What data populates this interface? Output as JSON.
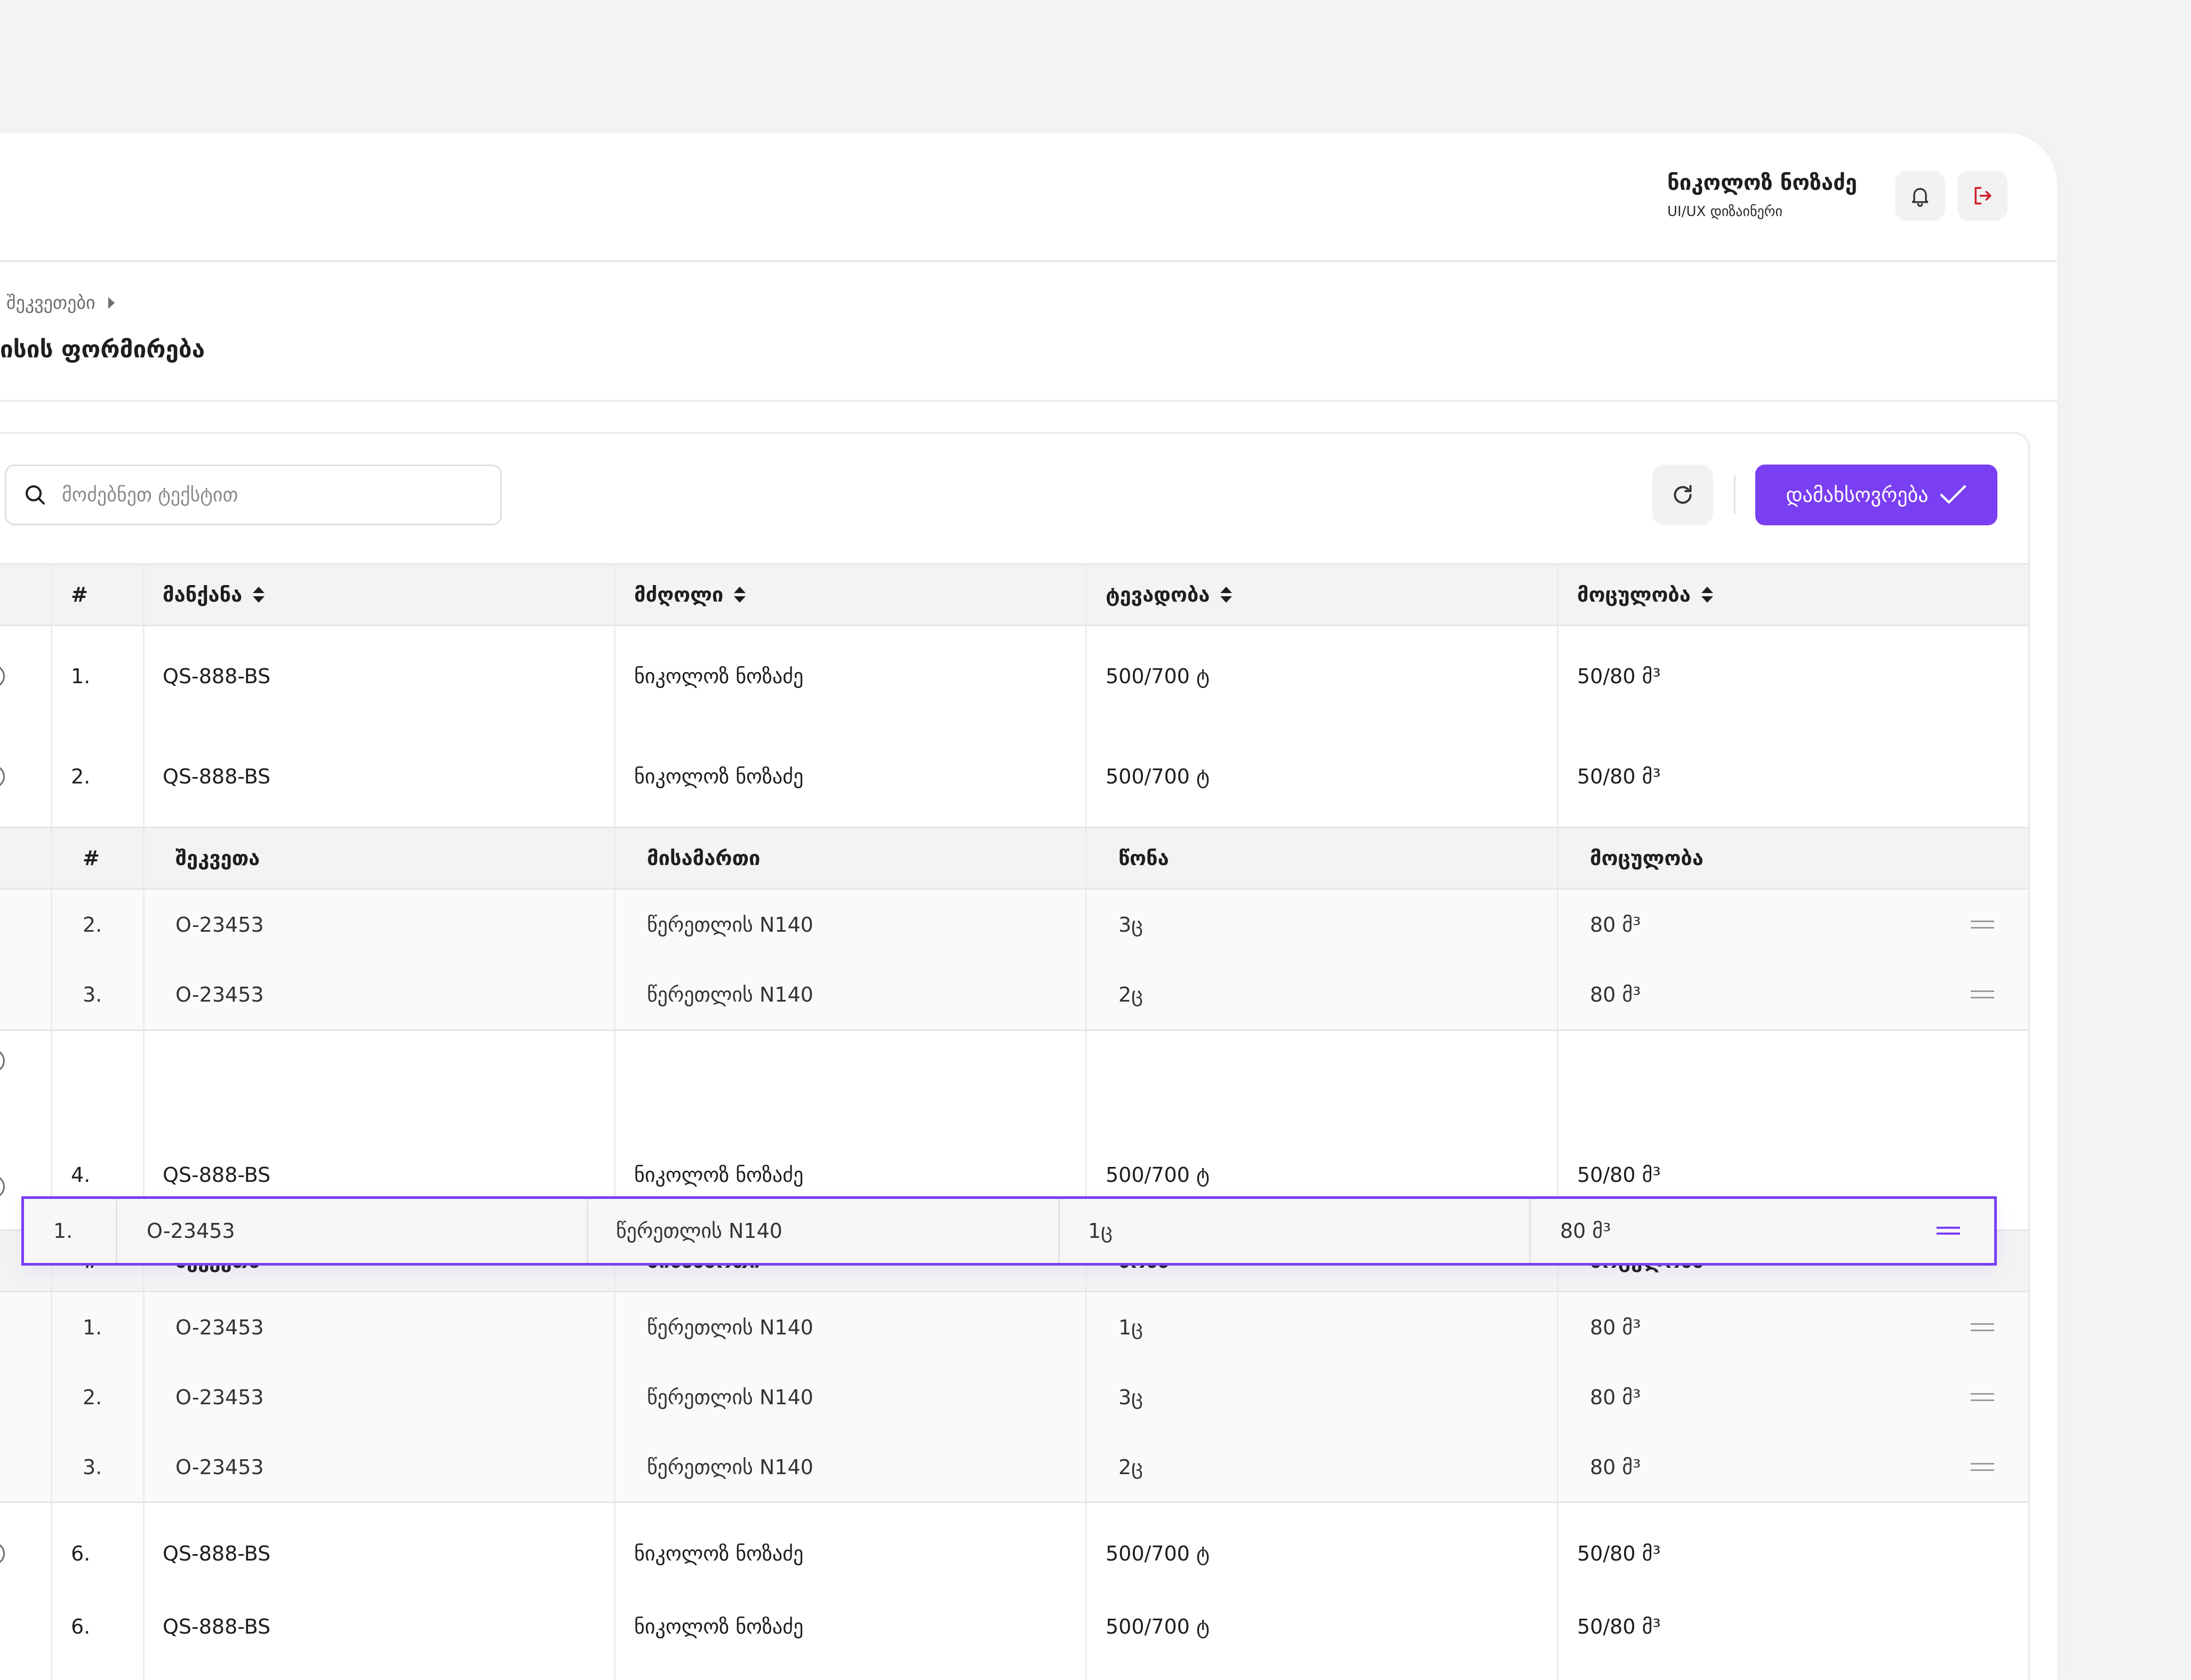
{
  "header": {
    "user_name": "ნიკოლოზ ნოზაძე",
    "user_role": "UI/UX დიზაინერი",
    "bell_icon": "bell-icon",
    "logout_icon": "logout-icon"
  },
  "breadcrumb": {
    "item": "შეკვეთები"
  },
  "page": {
    "title": "ისის ფორმირება"
  },
  "toolbar": {
    "search_placeholder": "მოძებნეთ ტექსტით",
    "search_value": "",
    "save_label": "დამახსოვრება",
    "accent_color": "#7a3ff2"
  },
  "table": {
    "columns": {
      "num": "#",
      "car": "მანქანა",
      "driver": "მძღოლი",
      "load": "ტევადობა",
      "volume": "მოცულობა"
    },
    "subcolumns": {
      "num": "#",
      "order": "შეკვეთა",
      "address": "მისამართი",
      "weight": "წონა",
      "volume": "მოცულობა"
    },
    "rows": [
      {
        "num": "1.",
        "car": "QS-888-BS",
        "driver": "ნიკოლოზ ნოზაძე",
        "load": "500/700 ტ",
        "volume": "50/80 მ³",
        "expanded": false
      },
      {
        "num": "2.",
        "car": "QS-888-BS",
        "driver": "ნიკოლოზ ნოზაძე",
        "load": "500/700 ტ",
        "volume": "50/80 მ³",
        "expanded": true,
        "items": [
          {
            "num": "2.",
            "order": "O-23453",
            "address": "წერეთლის N140",
            "weight": "3ც",
            "volume": "80 მ³"
          },
          {
            "num": "3.",
            "order": "O-23453",
            "address": "წერეთლის N140",
            "weight": "2ც",
            "volume": "80 მ³"
          }
        ]
      },
      {
        "num": "4.",
        "car": "QS-888-BS",
        "driver": "ნიკოლოზ ნოზაძე",
        "load": "500/700 ტ",
        "volume": "50/80 მ³",
        "expanded": true,
        "items": [
          {
            "num": "1.",
            "order": "O-23453",
            "address": "წერეთლის N140",
            "weight": "1ც",
            "volume": "80 მ³"
          },
          {
            "num": "2.",
            "order": "O-23453",
            "address": "წერეთლის N140",
            "weight": "3ც",
            "volume": "80 მ³"
          },
          {
            "num": "3.",
            "order": "O-23453",
            "address": "წერეთლის N140",
            "weight": "2ც",
            "volume": "80 მ³"
          }
        ]
      },
      {
        "num": "6.",
        "car": "QS-888-BS",
        "driver": "ნიკოლოზ ნოზაძე",
        "load": "500/700 ტ",
        "volume": "50/80 მ³",
        "expanded": false
      },
      {
        "num": "6.",
        "car": "QS-888-BS",
        "driver": "ნიკოლოზ ნოზაძე",
        "load": "500/700 ტ",
        "volume": "50/80 მ³",
        "expanded": false
      }
    ],
    "dragged_item": {
      "num": "1.",
      "order": "O-23453",
      "address": "წერეთლის N140",
      "weight": "1ც",
      "volume": "80 მ³"
    }
  }
}
